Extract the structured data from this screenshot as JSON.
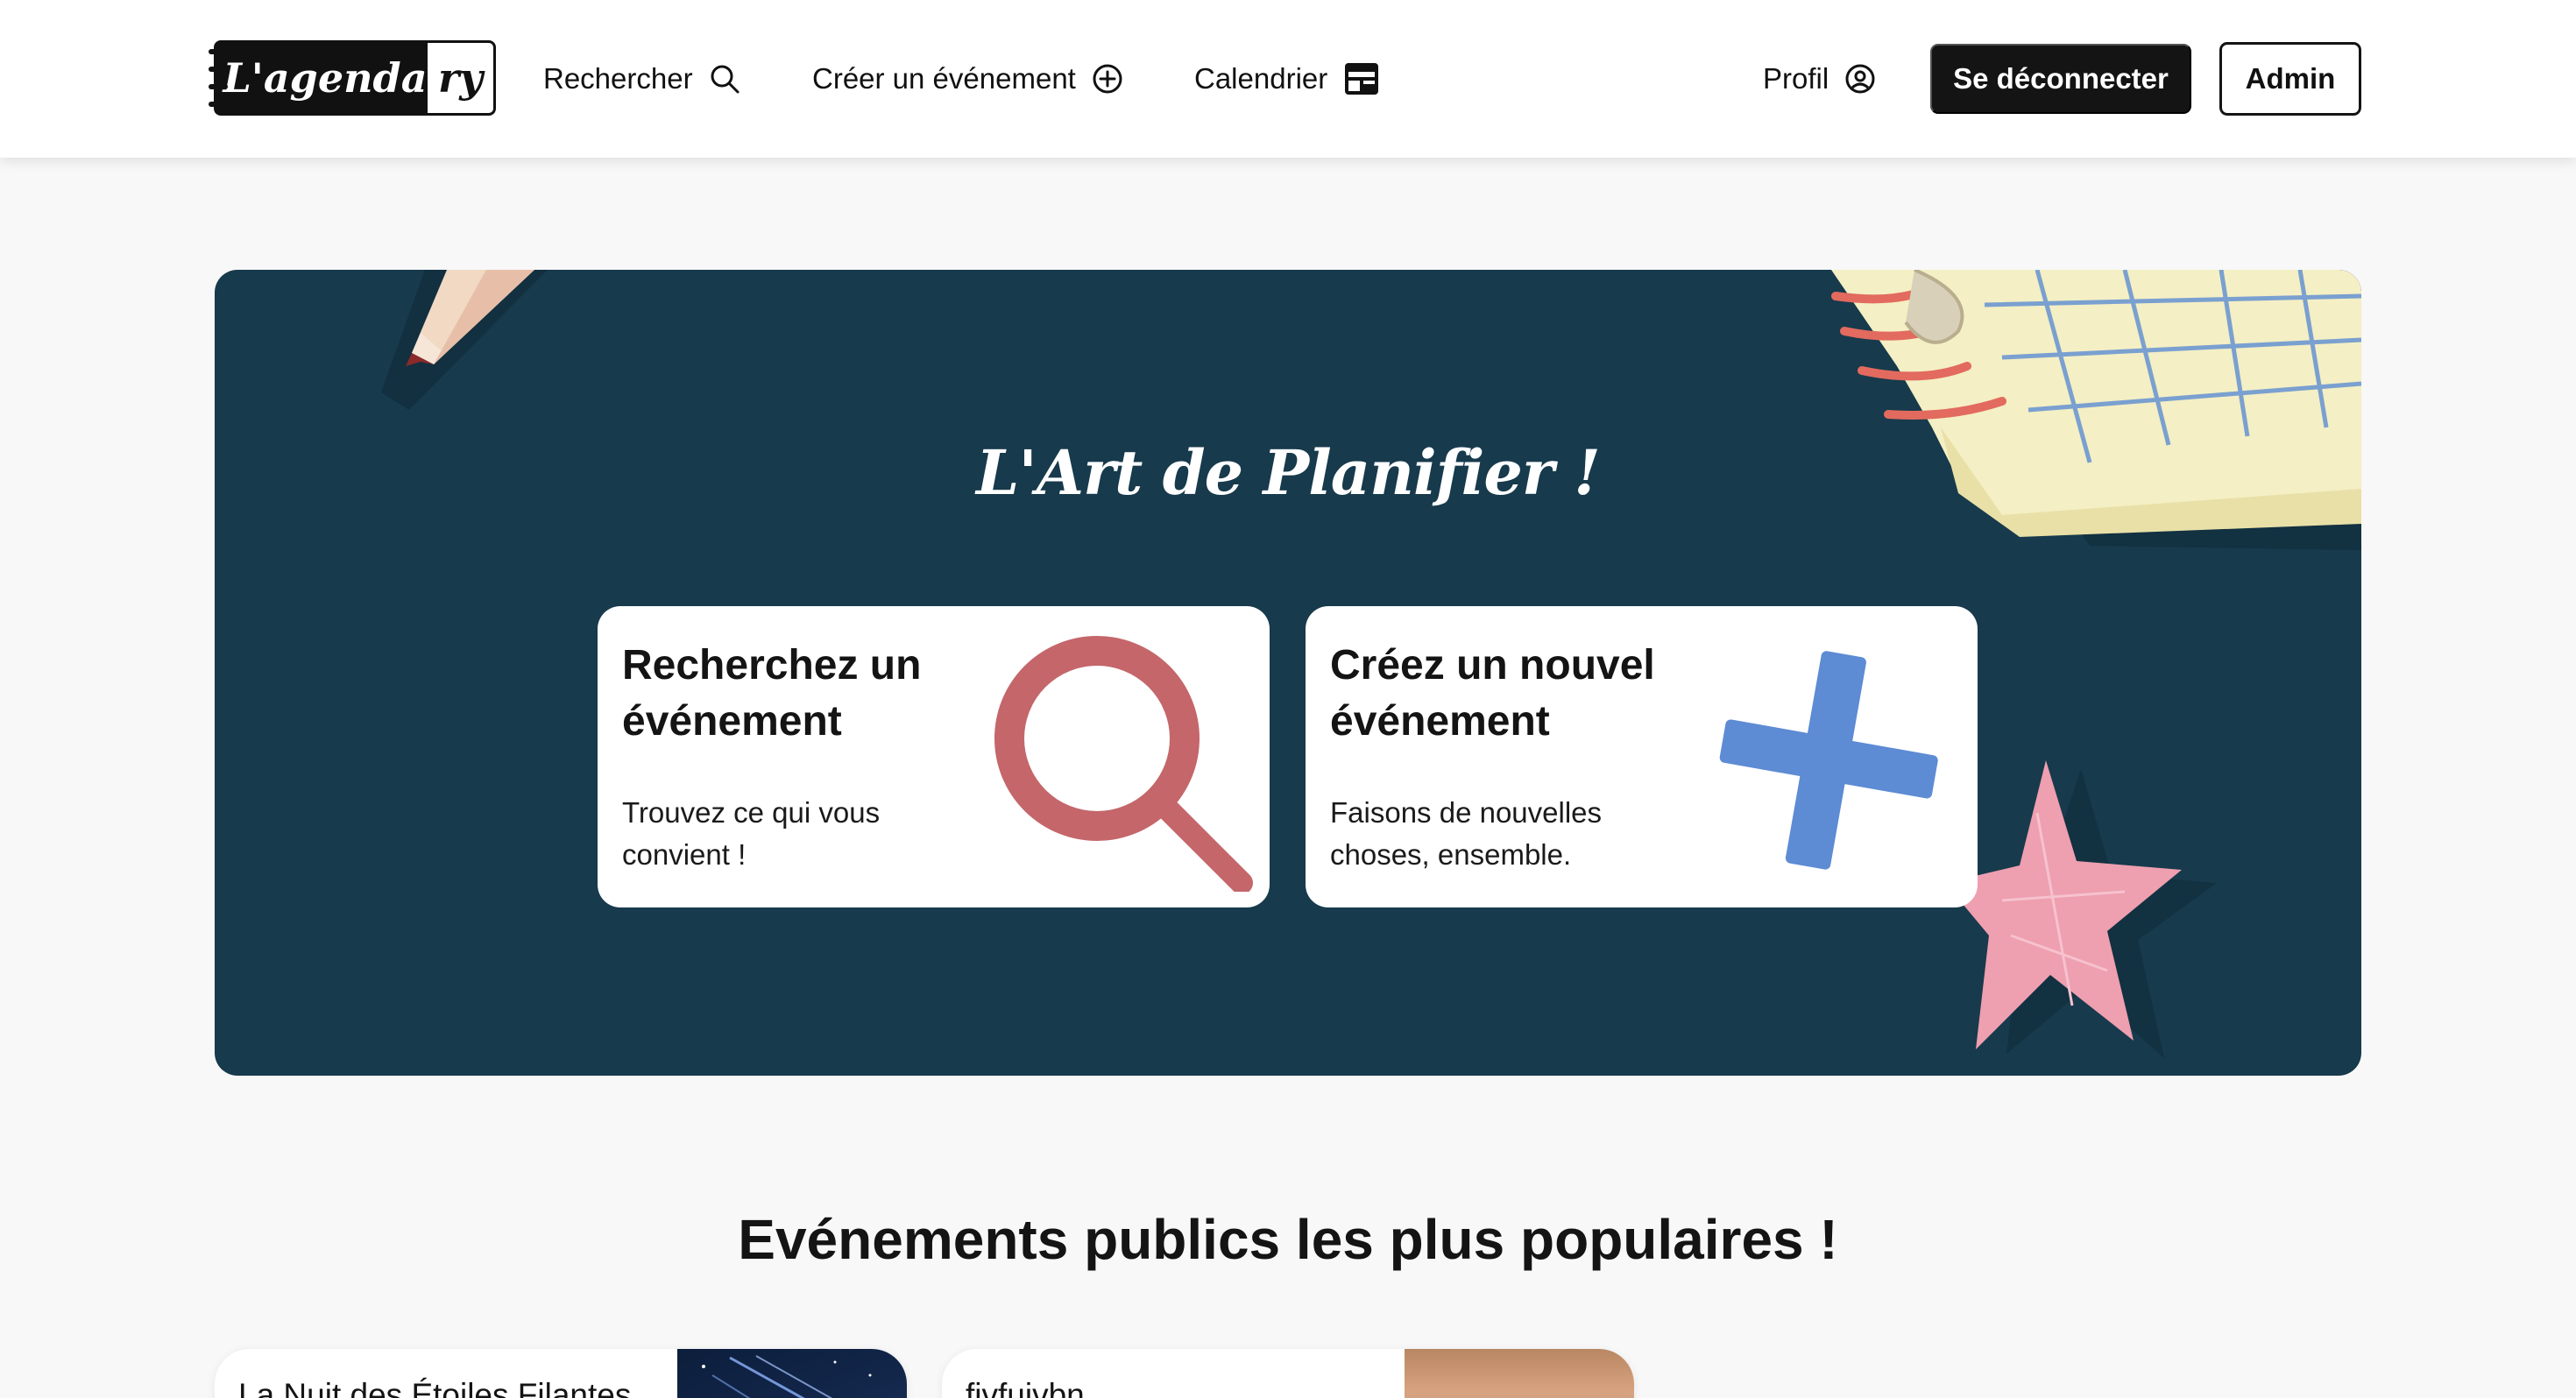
{
  "header": {
    "logo": {
      "left_text": "L'agenda",
      "right_text": "ry"
    },
    "nav": {
      "search_label": "Rechercher",
      "create_label": "Créer un événement",
      "calendar_label": "Calendrier",
      "profile_label": "Profil"
    },
    "logout_label": "Se déconnecter",
    "admin_label": "Admin",
    "icons": {
      "search": "search-icon",
      "create": "plus-circle-icon",
      "calendar": "calendar-icon",
      "profile": "user-circle-icon"
    }
  },
  "hero": {
    "title": "L'Art de Planifier !",
    "cards": [
      {
        "title": "Recherchez un événement",
        "subtitle": "Trouvez ce qui vous convient !",
        "icon": "magnifier-icon"
      },
      {
        "title": "Créez un nouvel événement",
        "subtitle": "Faisons de nouvelles choses, ensemble.",
        "icon": "plus-icon"
      }
    ]
  },
  "popular": {
    "title": "Evénements publics les plus populaires !",
    "events": [
      {
        "title": "La Nuit des Étoiles Filantes"
      },
      {
        "title": "fjvfujvbn"
      }
    ]
  },
  "colors": {
    "hero_bg": "#173a4c",
    "search_icon": "#c4666a",
    "plus_icon": "#5d8bd4",
    "star": "#ee9fb0",
    "button_dark": "#141414"
  }
}
